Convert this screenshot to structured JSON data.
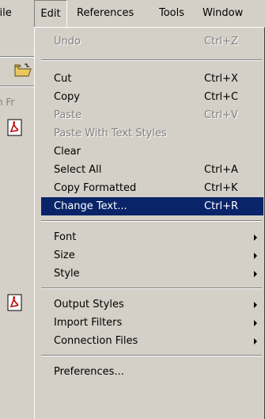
{
  "menubar": {
    "file": "File",
    "edit": "Edit",
    "references": "References",
    "tools": "Tools",
    "window": "Window"
  },
  "background": {
    "partial_text": "n Fr",
    "folder_icon": "open-folder-icon",
    "pdf_icon": "pdf-icon"
  },
  "edit_menu": {
    "undo": {
      "label": "Undo",
      "shortcut": "Ctrl+Z"
    },
    "cut": {
      "label": "Cut",
      "shortcut": "Ctrl+X"
    },
    "copy": {
      "label": "Copy",
      "shortcut": "Ctrl+C"
    },
    "paste": {
      "label": "Paste",
      "shortcut": "Ctrl+V"
    },
    "paste_with_styles": {
      "label": "Paste With Text Styles"
    },
    "clear": {
      "label": "Clear"
    },
    "select_all": {
      "label": "Select All",
      "shortcut": "Ctrl+A"
    },
    "copy_formatted": {
      "label": "Copy Formatted",
      "shortcut": "Ctrl+K"
    },
    "change_text": {
      "label": "Change Text...",
      "shortcut": "Ctrl+R"
    },
    "font": {
      "label": "Font"
    },
    "size": {
      "label": "Size"
    },
    "style": {
      "label": "Style"
    },
    "output_styles": {
      "label": "Output Styles"
    },
    "import_filters": {
      "label": "Import Filters"
    },
    "connection_files": {
      "label": "Connection Files"
    },
    "preferences": {
      "label": "Preferences..."
    }
  },
  "colors": {
    "menu_background": "#d4d0c8",
    "selection": "#0a246a",
    "disabled_text": "#808080"
  }
}
